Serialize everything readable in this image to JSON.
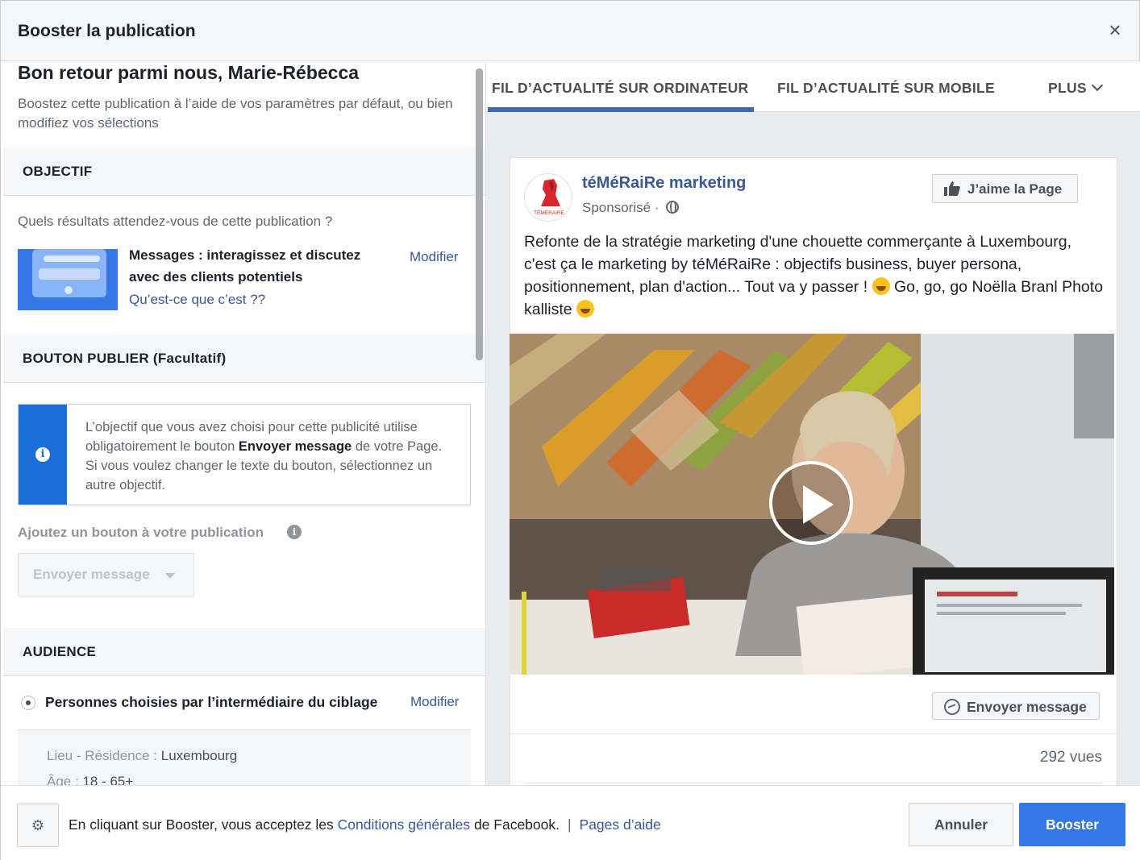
{
  "header": {
    "title": "Booster la publication",
    "close_icon": "close-icon"
  },
  "left": {
    "welcome_title": "Bon retour parmi nous, Marie-Rébecca",
    "welcome_sub": "Boostez cette publication à l’aide de vos paramètres par défaut, ou bien modifiez vos sélections",
    "objective": {
      "heading": "OBJECTIF",
      "question": "Quels résultats attendez-vous de cette publication ?",
      "choice_title": "Messages : interagissez et discutez avec des clients potentiels",
      "learn_link": "Qu’est-ce que c’est ??",
      "modify": "Modifier"
    },
    "button_section": {
      "heading": "BOUTON PUBLIER (Facultatif)",
      "info_before": "L’objectif que vous avez choisi pour cette publicité utilise obligatoirement le bouton ",
      "info_bold": "Envoyer message",
      "info_after": " de votre Page. Si vous voulez changer le texte du bouton, sélectionnez un autre objectif.",
      "add_label": "Ajoutez un bouton à votre publication",
      "dropdown_value": "Envoyer message"
    },
    "audience": {
      "heading": "AUDIENCE",
      "choice": "Personnes choisies par l’intermédiaire du ciblage",
      "modify": "Modifier",
      "location_label": "Lieu - Résidence : ",
      "location_value": "Luxembourg",
      "age_label": "Âge : ",
      "age_value": "18 - 65+"
    }
  },
  "right": {
    "tabs": [
      {
        "label": "FIL D’ACTUALITÉ SUR ORDINATEUR",
        "active": true
      },
      {
        "label": "FIL D’ACTUALITÉ SUR MOBILE",
        "active": false
      },
      {
        "label": "PLUS",
        "active": false
      }
    ],
    "post": {
      "page_name": "téMéRaiRe marketing",
      "sponsored": "Sponsorisé ·",
      "like_button": "J’aime la Page",
      "text_line1": "Refonte de la stratégie marketing d'une chouette commerçante à Luxembourg, c'est ça le marketing by téMéRaiRe : objectifs business, buyer persona, positionnement, plan d'action... Tout va y passer !",
      "text_line2": " Go, go, go Noëlla Branl Photo kalliste",
      "avatar_text": "TÉMÉRAIRE",
      "send_button": "Envoyer message",
      "views": "292 vues"
    }
  },
  "footer": {
    "text_before": "En cliquant sur Booster, vous acceptez les ",
    "terms_link": "Conditions générales",
    "text_after": " de Facebook.",
    "separator": "|",
    "help_link": "Pages d’aide",
    "cancel": "Annuler",
    "boost": "Booster"
  },
  "colors": {
    "primary": "#3578e5",
    "link": "#385898",
    "info_bar": "#1a6ed8"
  }
}
